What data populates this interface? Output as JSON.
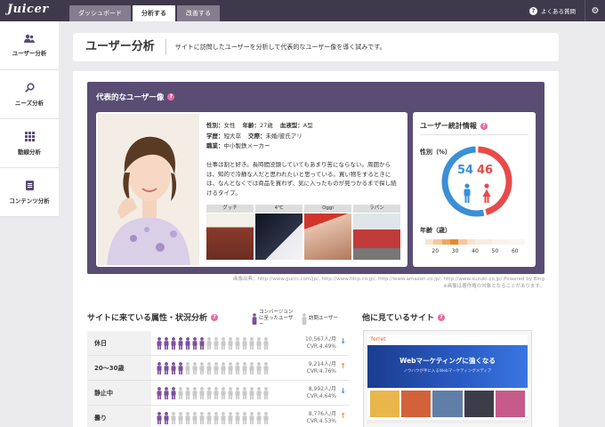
{
  "app": {
    "logo": "Juicer"
  },
  "header": {
    "tabs": [
      {
        "label": "ダッシュボード",
        "active": false
      },
      {
        "label": "分析する",
        "active": true
      },
      {
        "label": "改善する",
        "active": false
      }
    ],
    "faq_label": "よくある質問",
    "faq_icon": "question-circle-icon",
    "settings_icon": "gear-icon"
  },
  "sidebar": {
    "items": [
      {
        "label": "ユーザー分析",
        "icon": "users-icon"
      },
      {
        "label": "ニーズ分析",
        "icon": "magnifier-icon"
      },
      {
        "label": "動線分析",
        "icon": "grid-icon"
      },
      {
        "label": "コンテンツ分析",
        "icon": "document-icon"
      }
    ]
  },
  "page": {
    "title": "ユーザー分析",
    "description": "サイトに訪問したユーザーを分析して代表的なユーザー像を導く試みです。"
  },
  "persona": {
    "title": "代表的なユーザー像",
    "attributes": {
      "gender_label": "性別：",
      "gender": "女性",
      "age_label": "年齢：",
      "age": "27歳",
      "blood_label": "血液型：",
      "blood": "A型",
      "education_label": "学歴：",
      "education": "短大卒",
      "relationship_label": "交際：",
      "relationship": "未婚/彼氏アリ",
      "job_label": "職業：",
      "job": "中小製鉄メーカー"
    },
    "bio": "仕事は割と好き。長時間没頭していてもあまり苦にならない。周囲からは、知的で冷静な人だと思われたいと思っている。買い物をするときには、なんとなくでは商品を買わず、気に入ったものが見つかるまで探し続けるタイプ。",
    "brands": [
      {
        "label": "グッチ",
        "color": "#8a3b2b"
      },
      {
        "label": "4℃",
        "color": "#1d2230"
      },
      {
        "label": "Oggi",
        "color": "#c9a18e"
      },
      {
        "label": "ラパン",
        "color": "#b8c4cc"
      }
    ],
    "credit_line1": "画像出典：http://www.gucci.com/jp/, http://www.fdcp.co.jp/, http://www.amazon.co.jp/, http://www.suzuki.co.jp/ Powered by Bing",
    "credit_line2": "※画像は著作権の対象となることがあります。"
  },
  "stats": {
    "title": "ユーザー統計情報",
    "gender_title": "性別（%）",
    "male_pct": 54,
    "female_pct": 46,
    "male_color": "#3a8fd6",
    "female_color": "#e84a4a",
    "age_title": "年齢（歳）",
    "age_ticks": [
      "20",
      "30",
      "40",
      "50",
      "60"
    ],
    "age_bar_colors": [
      "#f7e3cc",
      "#f3c89c",
      "#eda762",
      "#e58a2c",
      "#f3c89c",
      "#f7e3cc",
      "#f8ece0",
      "#f8ece0",
      "#faf2ea",
      "#faf2ea",
      "#fbf6f1",
      "#fbf6f1"
    ]
  },
  "attributes_section": {
    "title": "サイトに来ている属性・状況分析",
    "legend_converted": "コンバージョンに至ったユーザー",
    "legend_visitors": "訪問ユーザー",
    "converted_color": "#7b4f9c",
    "visitor_color": "#c9c9c9",
    "rows": [
      {
        "label": "休日",
        "converted": 7,
        "total": 16,
        "visitors": "10,567人/月",
        "cvr": "CVR:4.49%",
        "trend": "down"
      },
      {
        "label": "20〜30歳",
        "converted": 4,
        "total": 16,
        "visitors": "9,214人/月",
        "cvr": "CVR:4.76%",
        "trend": "up"
      },
      {
        "label": "静止中",
        "converted": 3,
        "total": 16,
        "visitors": "8,992人/月",
        "cvr": "CVR:4.64%",
        "trend": "down"
      },
      {
        "label": "曇り",
        "converted": 2,
        "total": 16,
        "visitors": "8,776人/月",
        "cvr": "CVR:4.53%",
        "trend": "up"
      }
    ]
  },
  "other_sites": {
    "title": "他に見ているサイト",
    "site_logo": "ferret",
    "hero_title": "Webマーケティングに強くなる",
    "hero_sub": "ノウハウが手に入るWebマーケティングメディア"
  }
}
